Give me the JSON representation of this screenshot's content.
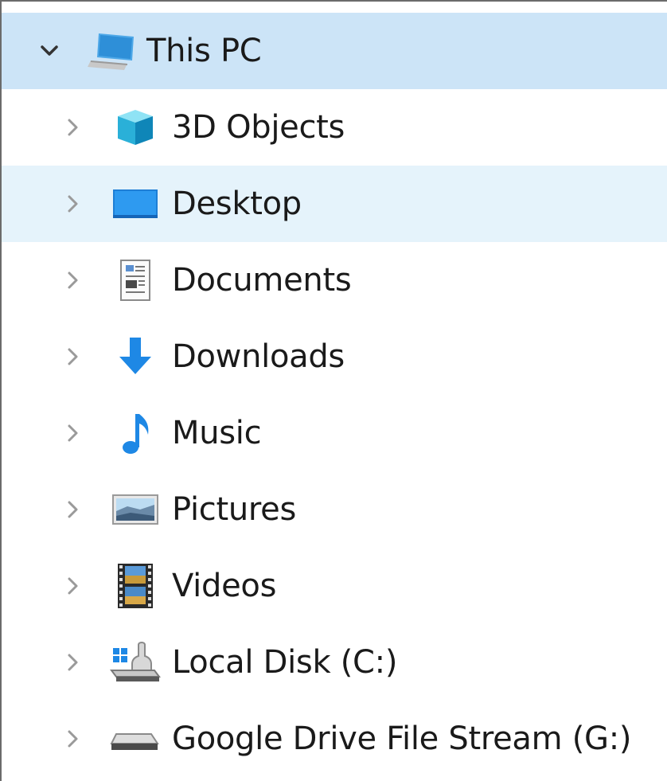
{
  "tree": {
    "root": {
      "label": "This PC",
      "expanded": true,
      "icon": "computer-icon"
    },
    "items": [
      {
        "label": "3D Objects",
        "icon": "3d-objects-icon"
      },
      {
        "label": "Desktop",
        "icon": "desktop-icon"
      },
      {
        "label": "Documents",
        "icon": "documents-icon"
      },
      {
        "label": "Downloads",
        "icon": "downloads-icon"
      },
      {
        "label": "Music",
        "icon": "music-icon"
      },
      {
        "label": "Pictures",
        "icon": "pictures-icon"
      },
      {
        "label": "Videos",
        "icon": "videos-icon"
      },
      {
        "label": "Local Disk (C:)",
        "icon": "local-disk-icon"
      },
      {
        "label": "Google Drive File Stream (G:)",
        "icon": "drive-icon"
      }
    ]
  },
  "colors": {
    "selected_bg": "#cce4f7",
    "hover_bg": "#e5f3fb",
    "accent_blue": "#1e88e5"
  }
}
